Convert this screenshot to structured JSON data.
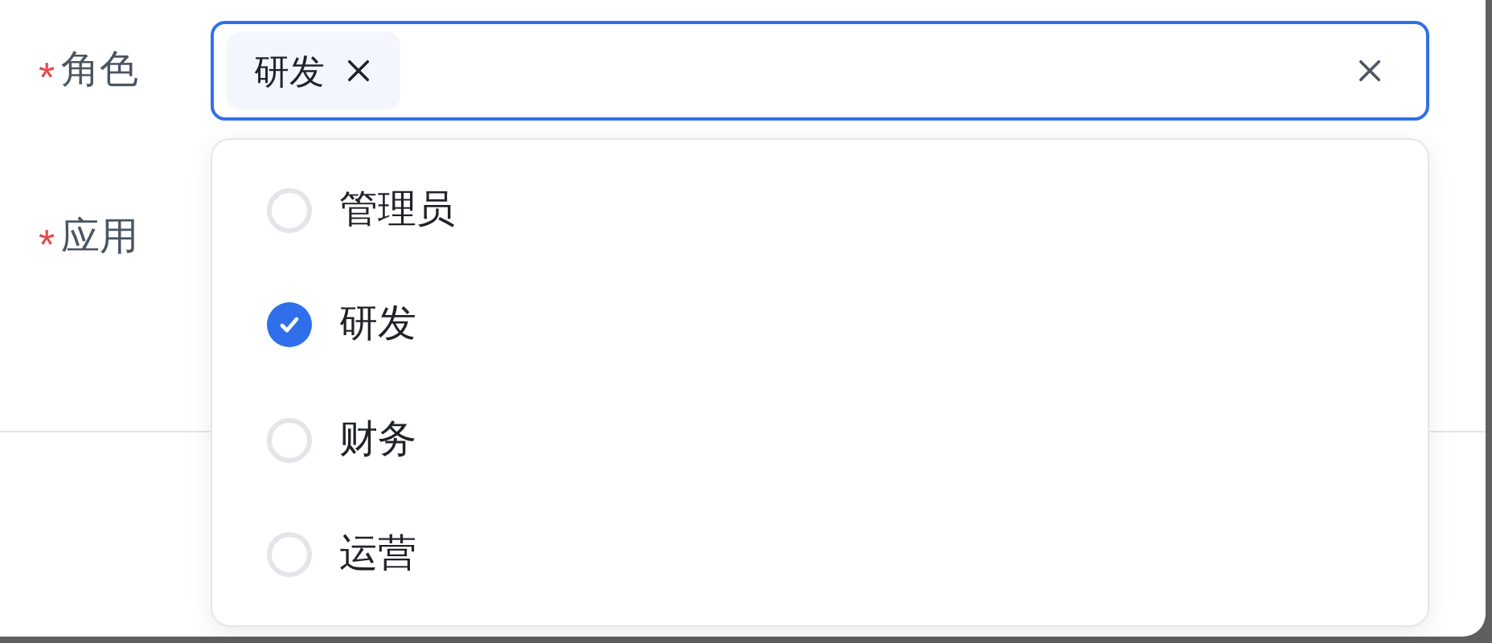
{
  "form": {
    "fields": [
      {
        "required_mark": "*",
        "label": "角色"
      },
      {
        "required_mark": "*",
        "label": "应用"
      }
    ]
  },
  "role_select": {
    "tags": [
      {
        "label": "研发"
      }
    ]
  },
  "dropdown": {
    "options": [
      {
        "label": "管理员",
        "checked": false
      },
      {
        "label": "研发",
        "checked": true
      },
      {
        "label": "财务",
        "checked": false
      },
      {
        "label": "运营",
        "checked": false
      }
    ]
  }
}
